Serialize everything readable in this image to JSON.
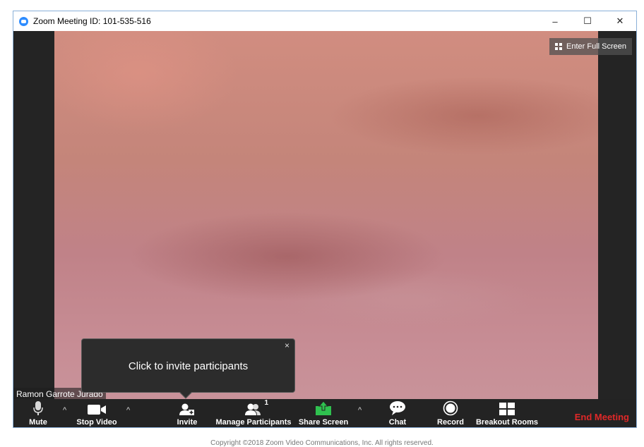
{
  "window": {
    "title": "Zoom Meeting ID: 101-535-516",
    "minimize": "–",
    "maximize": "☐",
    "close": "✕"
  },
  "video": {
    "fullscreen_label": "Enter Full Screen",
    "participant_name": "Ramon Garrote Jurado"
  },
  "tooltip": {
    "text": "Click to invite participants",
    "close": "×"
  },
  "toolbar": {
    "mute": "Mute",
    "stop_video": "Stop Video",
    "invite": "Invite",
    "manage_participants": "Manage Participants",
    "participant_count": "1",
    "share_screen": "Share Screen",
    "chat": "Chat",
    "record": "Record",
    "breakout_rooms": "Breakout Rooms",
    "end_meeting": "End Meeting",
    "caret": "^"
  },
  "footer": {
    "copyright": "Copyright ©2018 Zoom Video Communications, Inc. All rights reserved."
  },
  "colors": {
    "share_green": "#2fc14f",
    "end_red": "#e02828",
    "zoom_blue": "#2d8cff"
  }
}
